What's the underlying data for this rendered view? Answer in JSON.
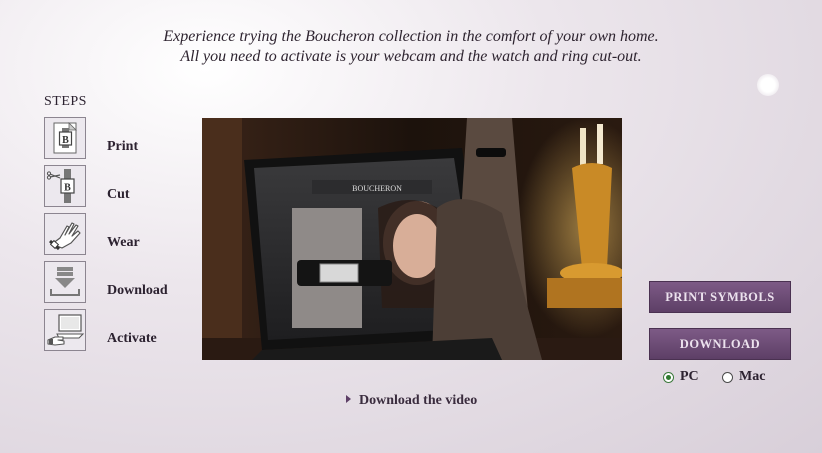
{
  "intro": {
    "line1": "Experience trying the Boucheron collection in the comfort of your own home.",
    "line2": "All you need to activate is your webcam and the watch and ring cut-out."
  },
  "steps": {
    "title": "STEPS",
    "items": [
      {
        "label": "Print",
        "icon": "print-icon"
      },
      {
        "label": "Cut",
        "icon": "scissors-icon"
      },
      {
        "label": "Wear",
        "icon": "hand-watch-icon"
      },
      {
        "label": "Download",
        "icon": "download-icon"
      },
      {
        "label": "Activate",
        "icon": "webcam-hand-icon"
      }
    ]
  },
  "video": {
    "brand_on_screen": "BOUCHERON"
  },
  "actions": {
    "print_symbols": "PRINT SYMBOLS",
    "download": "DOWNLOAD"
  },
  "platform": {
    "options": [
      "PC",
      "Mac"
    ],
    "selected": "PC"
  },
  "links": {
    "download_video": "Download the video"
  },
  "colors": {
    "button": "#6b4a74",
    "background": "#e6dfe7"
  }
}
